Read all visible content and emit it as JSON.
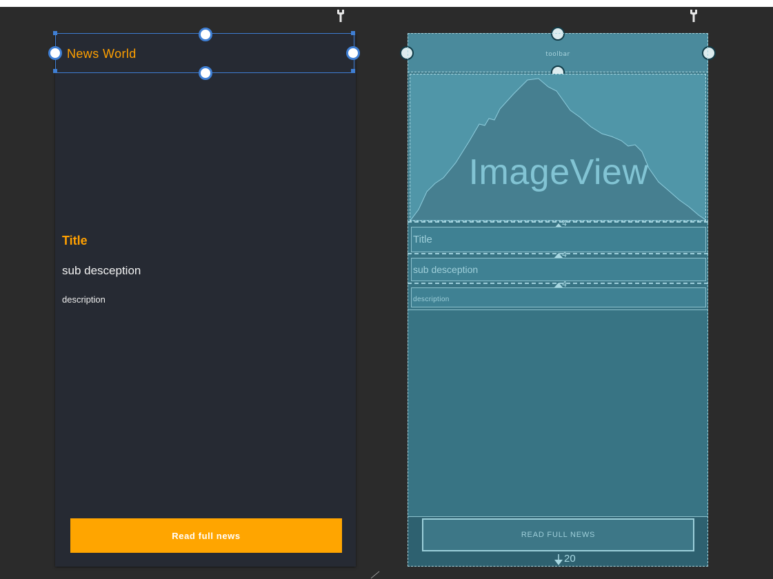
{
  "design": {
    "app_title": "News World",
    "title": "Title",
    "sub_description": "sub desception",
    "description": "description",
    "button_label": "Read full news"
  },
  "blueprint": {
    "toolbar_label": "toolbar",
    "image_label": "ImageView",
    "title": "Title",
    "sub_description": "sub desception",
    "description": "description",
    "button_label": "READ FULL NEWS",
    "spacing_marker": "4",
    "bottom_margin": "20"
  },
  "colors": {
    "accent": "#ffa000",
    "selection": "#3f7fd4",
    "blueprint": "#387484"
  }
}
